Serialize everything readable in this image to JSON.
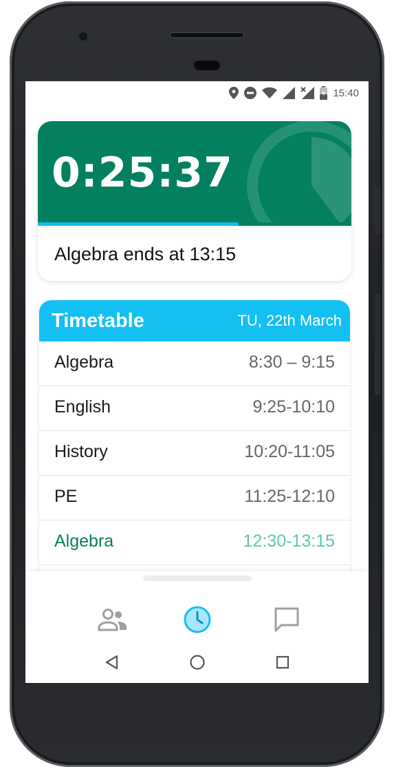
{
  "status_bar": {
    "time": "15:40",
    "icons": [
      "location-icon",
      "do-not-disturb-icon",
      "wifi-icon",
      "signal-icon",
      "signal-no-data-icon",
      "battery-charging-icon"
    ]
  },
  "timer": {
    "remaining": "0:25:37",
    "progress_fraction": 0.64,
    "ends_text": "Algebra ends at 13:15",
    "accent_color": "#03805f",
    "progress_color": "#11bdf0"
  },
  "timetable": {
    "title": "Timetable",
    "date": "TU, 22th March",
    "header_color": "#14bff2",
    "rows": [
      {
        "subject": "Algebra",
        "time": "8:30 – 9:15",
        "current": false
      },
      {
        "subject": "English",
        "time": "9:25-10:10",
        "current": false
      },
      {
        "subject": "History",
        "time": "10:20-11:05",
        "current": false
      },
      {
        "subject": "PE",
        "time": "11:25-12:10",
        "current": false
      },
      {
        "subject": "Algebra",
        "time": "12:30-13:15",
        "current": true
      }
    ]
  },
  "bottom_nav": {
    "items": [
      {
        "icon": "people-icon",
        "active": false
      },
      {
        "icon": "clock-icon",
        "active": true
      },
      {
        "icon": "chat-icon",
        "active": false
      }
    ]
  },
  "system_nav": {
    "icons": [
      "back-icon",
      "home-icon",
      "recent-apps-icon"
    ]
  }
}
